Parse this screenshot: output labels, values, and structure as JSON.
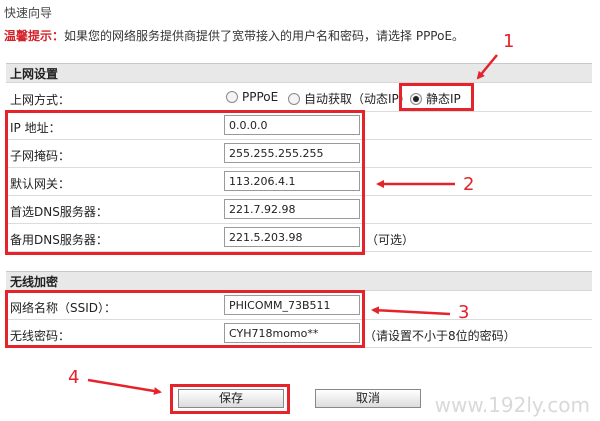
{
  "page_title": "快速向导",
  "hint": {
    "label": "温馨提示：",
    "text": "如果您的网络服务提供商提供了宽带接入的用户名和密码，请选择 PPPoE。"
  },
  "internet": {
    "section_title": "上网设置",
    "mode_label": "上网方式：",
    "modes": [
      "PPPoE",
      "自动获取（动态IP）",
      "静态IP"
    ],
    "selected_mode": "静态IP",
    "fields": [
      {
        "label": "IP 地址：",
        "value": "0.0.0.0"
      },
      {
        "label": "子网掩码：",
        "value": "255.255.255.255"
      },
      {
        "label": "默认网关：",
        "value": "113.206.4.1"
      },
      {
        "label": "首选DNS服务器：",
        "value": "221.7.92.98"
      },
      {
        "label": "备用DNS服务器：",
        "value": "221.5.203.98",
        "note": "（可选）"
      }
    ]
  },
  "wireless": {
    "section_title": "无线加密",
    "ssid_label": "网络名称（SSID）：",
    "ssid_value": "PHICOMM_73B511",
    "password_label": "无线密码：",
    "password_value": "CYH718momo**",
    "password_note": "（请设置不小于8位的密码）"
  },
  "buttons": {
    "save": "保存",
    "cancel": "取消"
  },
  "annotations": [
    "1",
    "2",
    "3",
    "4"
  ],
  "watermark": "www.192ly.com",
  "colors": {
    "annotation_red": "#e4232a",
    "hint_red": "#d4222a",
    "section_bg": "#e8e8e8"
  }
}
